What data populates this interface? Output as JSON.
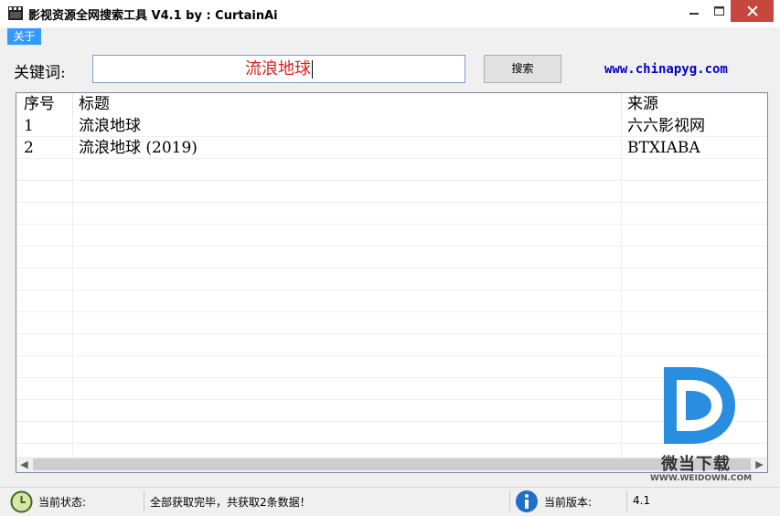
{
  "window": {
    "title": "影视资源全网搜索工具 V4.1 by : CurtainAi"
  },
  "menu": {
    "about": "关于"
  },
  "search": {
    "label": "关键词:",
    "value": "流浪地球",
    "button": "搜索"
  },
  "site": {
    "url": "www.chinapyg.com"
  },
  "table": {
    "headers": [
      "序号",
      "标题",
      "来源"
    ],
    "rows": [
      [
        "1",
        "流浪地球",
        "六六影视网"
      ],
      [
        "2",
        "流浪地球 (2019)",
        "BTXIABA"
      ]
    ]
  },
  "watermark": {
    "name": "微当下载",
    "url": "WWW.WEIDOWN.COM"
  },
  "status": {
    "state_label": "当前状态:",
    "state_value": "全部获取完毕，共获取2条数据！",
    "version_label": "当前版本:",
    "version_value": "4.1"
  },
  "colors": {
    "menu_highlight": "#3399ff",
    "keyword_text": "#e0201f",
    "link": "#0000cc",
    "close_button": "#c7463d",
    "logo_blue": "#2a8ee0"
  },
  "icons": [
    "app-icon",
    "minimize-icon",
    "maximize-icon",
    "close-icon",
    "scroll-left-icon",
    "scroll-right-icon",
    "clock-status-icon",
    "info-icon"
  ]
}
